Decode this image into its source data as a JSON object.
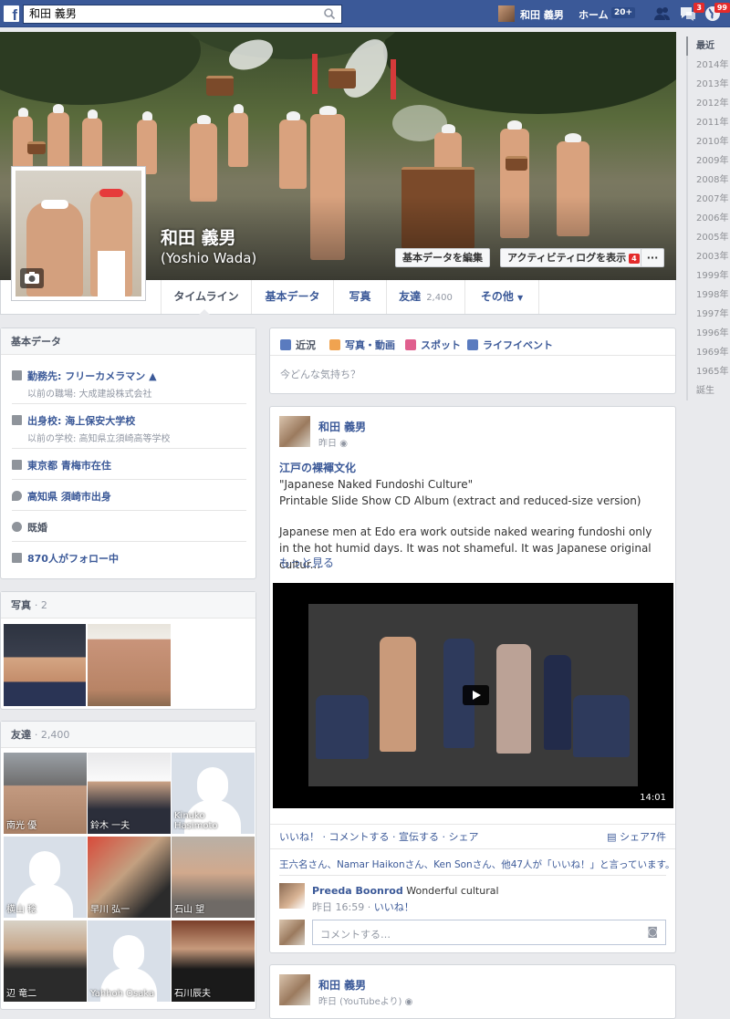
{
  "topbar": {
    "search_value": "和田 義男",
    "user_name": "和田 義男",
    "home_label": "ホーム",
    "home_count": "20+",
    "messages_badge": "3",
    "notifications_badge": "99"
  },
  "timeline_years": [
    "最近",
    "2014年",
    "2013年",
    "2012年",
    "2011年",
    "2010年",
    "2009年",
    "2008年",
    "2007年",
    "2006年",
    "2005年",
    "2003年",
    "1999年",
    "1998年",
    "1997年",
    "1996年",
    "1969年",
    "1965年",
    "誕生"
  ],
  "profile": {
    "name": "和田 義男",
    "alt_name": "(Yoshio Wada)",
    "edit_button": "基本データを編集",
    "activity_button": "アクティビティログを表示",
    "activity_count": "4",
    "more_button": "···"
  },
  "tabs": {
    "timeline": "タイムライン",
    "about": "基本データ",
    "photos": "写真",
    "friends": "友達",
    "friends_count": "2,400",
    "more": "その他"
  },
  "about": {
    "title": "基本データ",
    "work": "勤務先: フリーカメラマン",
    "work_prev": "以前の職場: 大成建設株式会社",
    "school": "出身校: 海上保安大学校",
    "school_prev": "以前の学校: 高知県立須崎高等学校",
    "lives": "東京都 青梅市在住",
    "from": "高知県 須崎市出身",
    "relationship": "既婚",
    "followers": "870人がフォロー中"
  },
  "photos_card": {
    "title": "写真",
    "count": "· 2"
  },
  "friends_card": {
    "title": "友達",
    "count": "2,400",
    "items": [
      "南光 優",
      "鈴木 一夫",
      "Kinuko Hasimoto",
      "横山 稔",
      "早川 弘一",
      "石山 望",
      "辺 竜二",
      "Yahhoh Osaka",
      "石川辰夫"
    ]
  },
  "composer": {
    "status": "近況",
    "photo": "写真・動画",
    "place": "スポット",
    "life_event": "ライフイベント",
    "placeholder": "今どんな気持ち？"
  },
  "post1": {
    "author": "和田 義男",
    "time": "昨日",
    "title": "江戸の裸褌文化",
    "line1": "\"Japanese Naked Fundoshi Culture\"",
    "line2": "Printable Slide Show CD Album (extract and reduced-size version)",
    "body": "Japanese men at Edo era work outside naked wearing fundoshi only in the hot humid days. It was not shameful. It was Japanese original cultur...",
    "more": "もっと見る",
    "video_duration": "14:01",
    "actions": "いいね！ · コメントする · 宣伝する · シェア",
    "share_count": "シェア7件",
    "likes": "王六名さん、Namar Haikonさん、Ken Sonさん、他47人が「いいね！」と言っています。",
    "comment_author": "Preeda Boonrod",
    "comment_text": "Wonderful cultural",
    "comment_time": "昨日 16:59 ·",
    "comment_like": "いいね！",
    "comment_placeholder": "コメントする…"
  },
  "post2": {
    "author": "和田 義男",
    "time": "昨日 (YouTubeより)"
  }
}
